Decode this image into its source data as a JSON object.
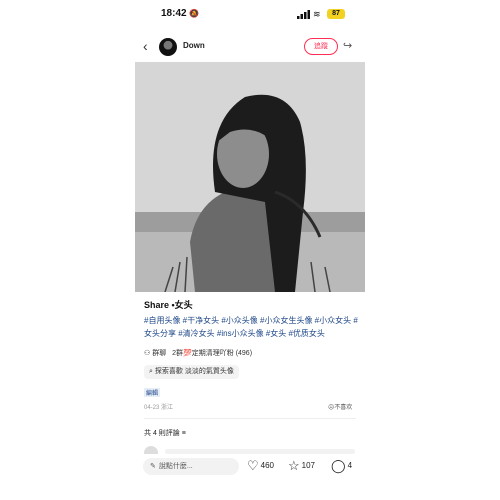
{
  "status_bar": {
    "time": "18:42",
    "battery": "87"
  },
  "header": {
    "author": "Down",
    "follow_label": "追蹤"
  },
  "post": {
    "title": "Share •女头",
    "tags": "#自用头像 #干净女头 #小众头像 #小众女生头像 #小众女头 #女头分享 #清冷女头 #ins小众头像 #女头 #优质女头",
    "group_label": "群聊",
    "group_text": "2群",
    "group_badge": "💯",
    "group_name": "定期清理吖粉 (496)",
    "search_chip": "探索喜歡  淡淡的氣質头像",
    "small_badge": "編輯",
    "date_location": "04-23 浙江",
    "dislike_label": "不喜欢"
  },
  "comments": {
    "header": "共 4 則評論"
  },
  "bottom_bar": {
    "input_placeholder": "說點什麼...",
    "likes": "460",
    "favorites": "107",
    "comment_count": "4"
  }
}
